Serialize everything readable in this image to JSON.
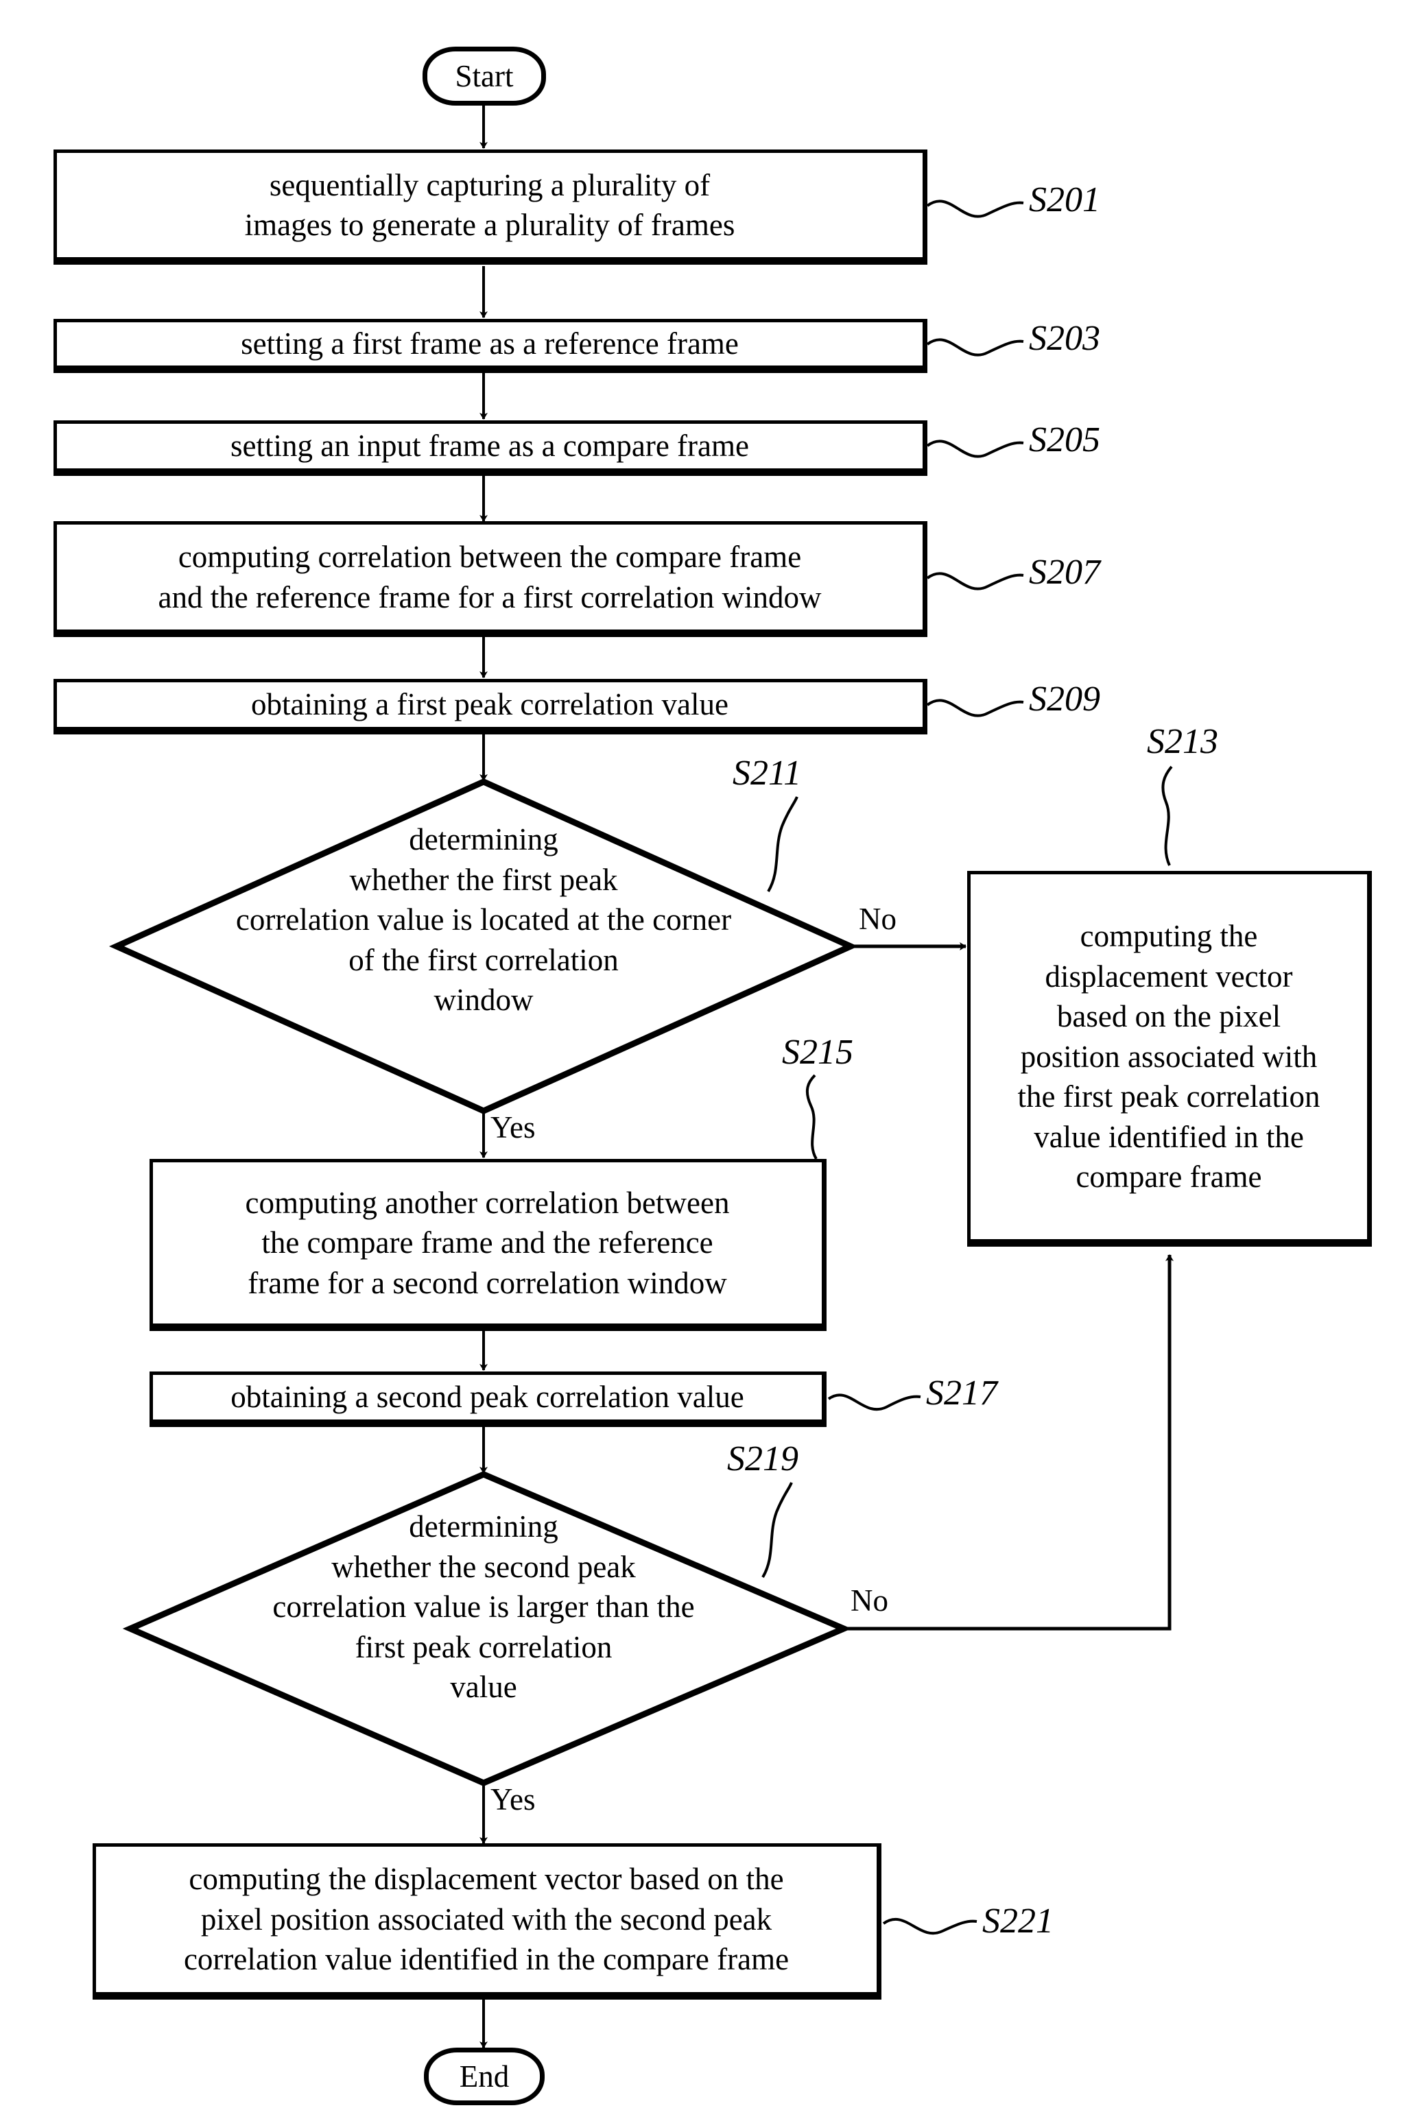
{
  "figure": {
    "type": "flowchart",
    "orientation": "vertical",
    "line_color": "#000000",
    "background_color": "#ffffff"
  },
  "nodes": {
    "start": {
      "label": "Start",
      "shape": "terminator"
    },
    "s201": {
      "label": "sequentially capturing a plurality of\nimages to generate a plurality of frames",
      "line1": "sequentially capturing a plurality of",
      "line2": "images to generate a plurality of frames",
      "ref": "S201",
      "shape": "process"
    },
    "s203": {
      "label": "setting a first frame as a reference frame",
      "ref": "S203",
      "shape": "process"
    },
    "s205": {
      "label": "setting an input frame as a compare frame",
      "ref": "S205",
      "shape": "process"
    },
    "s207": {
      "line1": "computing correlation between the compare frame",
      "line2": "and the reference frame for a first correlation window",
      "ref": "S207",
      "shape": "process"
    },
    "s209": {
      "label": "obtaining a first peak correlation value",
      "ref": "S209",
      "shape": "process"
    },
    "s211": {
      "line1": "determining",
      "line2": "whether the first peak",
      "line3": "correlation value is located at the corner",
      "line4": "of the first correlation",
      "line5": "window",
      "ref": "S211",
      "shape": "decision"
    },
    "s213": {
      "line1": "computing the",
      "line2": "displacement vector",
      "line3": "based on the pixel",
      "line4": "position associated with",
      "line5": "the first peak correlation",
      "line6": "value identified in the",
      "line7": "compare frame",
      "ref": "S213",
      "shape": "process"
    },
    "s215": {
      "line1": "computing another correlation between",
      "line2": "the compare frame and the reference",
      "line3": "frame for a second correlation window",
      "ref": "S215",
      "shape": "process"
    },
    "s217": {
      "label": "obtaining a second peak correlation value",
      "ref": "S217",
      "shape": "process"
    },
    "s219": {
      "line1": "determining",
      "line2": "whether the second peak",
      "line3": "correlation value is larger than the",
      "line4": "first peak correlation",
      "line5": "value",
      "ref": "S219",
      "shape": "decision"
    },
    "s221": {
      "line1": "computing the displacement vector based on the",
      "line2": "pixel position associated with the second peak",
      "line3": "correlation value identified in the compare frame",
      "ref": "S221",
      "shape": "process"
    },
    "end": {
      "label": "End",
      "shape": "terminator"
    }
  },
  "edge_labels": {
    "s211_no": "No",
    "s211_yes": "Yes",
    "s219_no": "No",
    "s219_yes": "Yes"
  }
}
